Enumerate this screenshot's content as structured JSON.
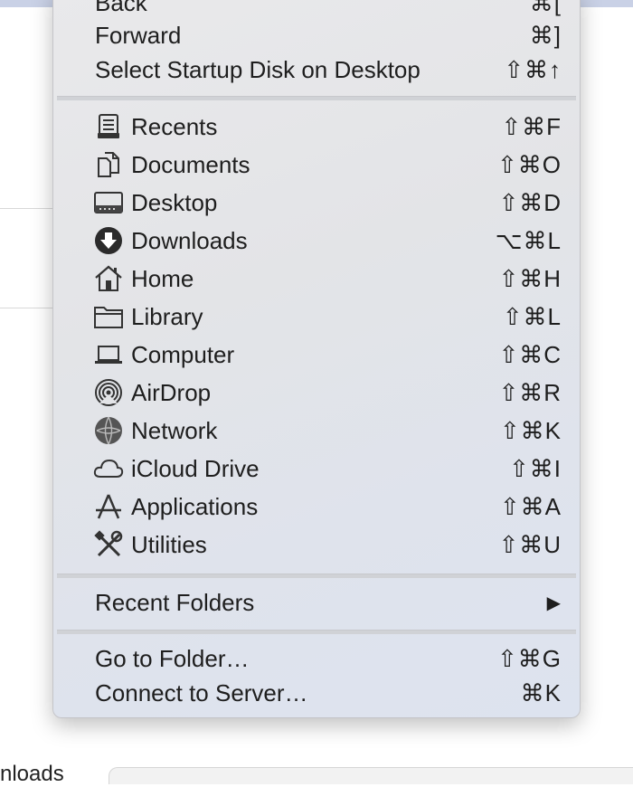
{
  "background": {
    "bottom_partial_text": "nloads"
  },
  "menu": {
    "top_items": [
      {
        "label": "Back",
        "shortcut": "⌘["
      },
      {
        "label": "Forward",
        "shortcut": "⌘]"
      },
      {
        "label": "Select Startup Disk on Desktop",
        "shortcut": "⇧⌘↑"
      }
    ],
    "places": [
      {
        "label": "Recents",
        "shortcut": "⇧⌘F",
        "icon": "recents-icon"
      },
      {
        "label": "Documents",
        "shortcut": "⇧⌘O",
        "icon": "documents-icon"
      },
      {
        "label": "Desktop",
        "shortcut": "⇧⌘D",
        "icon": "desktop-icon"
      },
      {
        "label": "Downloads",
        "shortcut": "⌥⌘L",
        "icon": "downloads-icon"
      },
      {
        "label": "Home",
        "shortcut": "⇧⌘H",
        "icon": "home-icon"
      },
      {
        "label": "Library",
        "shortcut": "⇧⌘L",
        "icon": "library-folder-icon"
      },
      {
        "label": "Computer",
        "shortcut": "⇧⌘C",
        "icon": "computer-icon"
      },
      {
        "label": "AirDrop",
        "shortcut": "⇧⌘R",
        "icon": "airdrop-icon"
      },
      {
        "label": "Network",
        "shortcut": "⇧⌘K",
        "icon": "network-globe-icon"
      },
      {
        "label": "iCloud Drive",
        "shortcut": "⇧⌘I",
        "icon": "cloud-icon"
      },
      {
        "label": "Applications",
        "shortcut": "⇧⌘A",
        "icon": "applications-icon"
      },
      {
        "label": "Utilities",
        "shortcut": "⇧⌘U",
        "icon": "utilities-tools-icon"
      }
    ],
    "recent_folders": {
      "label": "Recent Folders",
      "submenu_glyph": "▶"
    },
    "bottom_items": [
      {
        "label": "Go to Folder…",
        "shortcut": "⇧⌘G"
      },
      {
        "label": "Connect to Server…",
        "shortcut": "⌘K"
      }
    ]
  }
}
